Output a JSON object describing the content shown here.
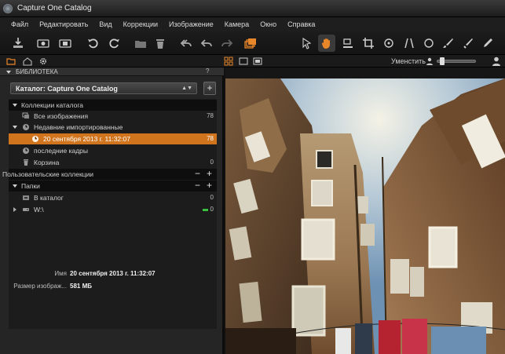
{
  "window": {
    "title": "Capture One Catalog"
  },
  "menu": [
    "Файл",
    "Редактировать",
    "Вид",
    "Коррекции",
    "Изображение",
    "Камера",
    "Окно",
    "Справка"
  ],
  "toolbar": {
    "left_icons": [
      "import-icon",
      "capture-icon",
      "compare-icon",
      "rotate-left-icon",
      "rotate-right-icon",
      "move-to-folder-icon",
      "trash-icon",
      "undo-all-icon",
      "undo-icon",
      "redo-icon",
      "variants-icon"
    ],
    "right_icons": [
      "pointer-tool-icon",
      "pan-hand-tool-icon",
      "loupe-tool-icon",
      "crop-tool-icon",
      "rotate-tool-icon",
      "keystone-tool-icon",
      "spot-removal-tool-icon",
      "brush-tool-icon",
      "eraser-tool-icon",
      "color-picker-tool-icon"
    ],
    "accent_color": "#e8862a"
  },
  "subbar": {
    "unsharp_label": "Уменстить"
  },
  "library": {
    "header": "БИБЛИОТЕКА",
    "help": "?",
    "catalog_select": "Каталог: Capture One Catalog",
    "add_button": "+",
    "sections": {
      "catalog_collections": "Коллекции каталога",
      "user_collections": "Пользовательские коллекции",
      "folders": "Папки"
    },
    "items": {
      "all_images": {
        "label": "Все изображения",
        "count": "78"
      },
      "recent_imports": {
        "label": "Недавние импортированные"
      },
      "import_date": {
        "label": "20 сентября 2013 г. 11:32:07",
        "count": "78"
      },
      "recent_captures": {
        "label": "последние кадры"
      },
      "trash": {
        "label": "Корзина",
        "count": "0"
      },
      "in_catalog": {
        "label": "В каталог",
        "count": "0"
      },
      "drive_w": {
        "label": "W:\\",
        "count": "0"
      }
    },
    "header_minus": "−",
    "header_plus": "+"
  },
  "info": {
    "name_key": "Имя",
    "name_value": "20 сентября 2013 г. 11:32:07",
    "size_key": "Размер изображ...",
    "size_value": "581 МБ"
  },
  "colors": {
    "selection": "#d0751e",
    "indicator_green": "#39c03d"
  }
}
